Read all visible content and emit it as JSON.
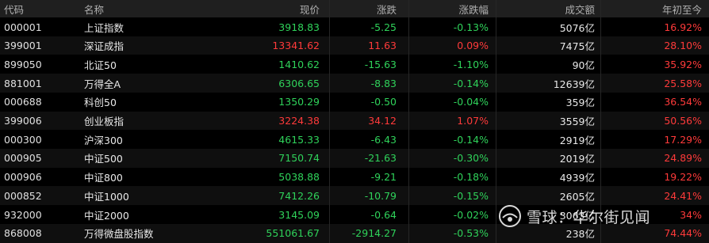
{
  "header": {
    "code": "代码",
    "name": "名称",
    "price": "现价",
    "change": "涨跌",
    "change_pct": "涨跌幅",
    "amount": "成交额",
    "ytd": "年初至今"
  },
  "rows": [
    {
      "code": "000001",
      "name": "上证指数",
      "price": "3918.83",
      "change": "-5.25",
      "change_pct": "-0.13%",
      "amount": "5076亿",
      "ytd": "16.92%",
      "dir": "down"
    },
    {
      "code": "399001",
      "name": "深证成指",
      "price": "13341.62",
      "change": "11.63",
      "change_pct": "0.09%",
      "amount": "7475亿",
      "ytd": "28.10%",
      "dir": "up"
    },
    {
      "code": "899050",
      "name": "北证50",
      "price": "1410.62",
      "change": "-15.63",
      "change_pct": "-1.10%",
      "amount": "90亿",
      "ytd": "35.92%",
      "dir": "down"
    },
    {
      "code": "881001",
      "name": "万得全A",
      "price": "6306.65",
      "change": "-8.83",
      "change_pct": "-0.14%",
      "amount": "12639亿",
      "ytd": "25.58%",
      "dir": "down"
    },
    {
      "code": "000688",
      "name": "科创50",
      "price": "1350.29",
      "change": "-0.50",
      "change_pct": "-0.04%",
      "amount": "359亿",
      "ytd": "36.54%",
      "dir": "down"
    },
    {
      "code": "399006",
      "name": "创业板指",
      "price": "3224.38",
      "change": "34.12",
      "change_pct": "1.07%",
      "amount": "3559亿",
      "ytd": "50.56%",
      "dir": "up"
    },
    {
      "code": "000300",
      "name": "沪深300",
      "price": "4615.33",
      "change": "-6.43",
      "change_pct": "-0.14%",
      "amount": "2919亿",
      "ytd": "17.29%",
      "dir": "down"
    },
    {
      "code": "000905",
      "name": "中证500",
      "price": "7150.74",
      "change": "-21.63",
      "change_pct": "-0.30%",
      "amount": "2019亿",
      "ytd": "24.89%",
      "dir": "down"
    },
    {
      "code": "000906",
      "name": "中证800",
      "price": "5038.88",
      "change": "-9.21",
      "change_pct": "-0.18%",
      "amount": "4939亿",
      "ytd": "19.22%",
      "dir": "down"
    },
    {
      "code": "000852",
      "name": "中证1000",
      "price": "7412.26",
      "change": "-10.79",
      "change_pct": "-0.15%",
      "amount": "2605亿",
      "ytd": "24.41%",
      "dir": "down"
    },
    {
      "code": "932000",
      "name": "中证2000",
      "price": "3145.09",
      "change": "-0.64",
      "change_pct": "-0.02%",
      "amount": "3063亿",
      "ytd": "34%",
      "dir": "down"
    },
    {
      "code": "868008",
      "name": "万得微盘股指数",
      "price": "551061.67",
      "change": "-2914.27",
      "change_pct": "-0.53%",
      "amount": "238亿",
      "ytd": "74.44%",
      "dir": "down"
    }
  ],
  "watermark": {
    "text": "雪球：华尔街见闻",
    "icon": "snowball-logo-icon"
  },
  "colors": {
    "up": "#ff3a3a",
    "down": "#2fd25a",
    "background": "#000000",
    "header_background": "#1f1f1f"
  }
}
